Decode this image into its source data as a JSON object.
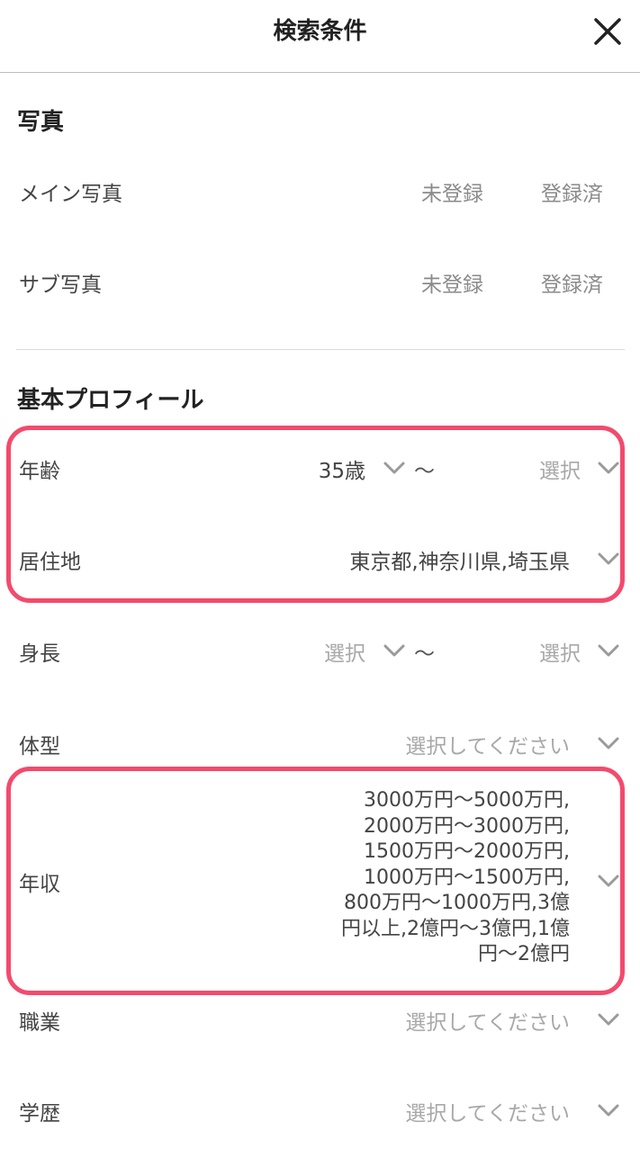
{
  "header": {
    "title": "検索条件",
    "close_icon": "close-icon"
  },
  "photo_section": {
    "title": "写真",
    "rows": [
      {
        "label": "メイン写真",
        "options": [
          "未登録",
          "登録済"
        ]
      },
      {
        "label": "サブ写真",
        "options": [
          "未登録",
          "登録済"
        ]
      }
    ]
  },
  "basic_profile": {
    "title": "基本プロフィール",
    "age": {
      "label": "年齢",
      "min": "35歳",
      "separator": "〜",
      "max": "選択"
    },
    "residence": {
      "label": "居住地",
      "value": "東京都,神奈川県,埼玉県"
    },
    "height": {
      "label": "身長",
      "min": "選択",
      "separator": "〜",
      "max": "選択"
    },
    "body_type": {
      "label": "体型",
      "value": "選択してください"
    },
    "income": {
      "label": "年収",
      "lines": [
        "3000万円〜5000万円,",
        "2000万円〜3000万円,",
        "1500万円〜2000万円,",
        "1000万円〜1500万円,",
        "800万円〜1000万円,3億",
        "円以上,2億円〜3億円,1億",
        "円〜2億円"
      ]
    },
    "occupation": {
      "label": "職業",
      "value": "選択してください"
    },
    "education": {
      "label": "学歴",
      "value": "選択してください"
    }
  },
  "colors": {
    "highlight": "#f24b6d",
    "muted_text": "#a8a8a8"
  }
}
